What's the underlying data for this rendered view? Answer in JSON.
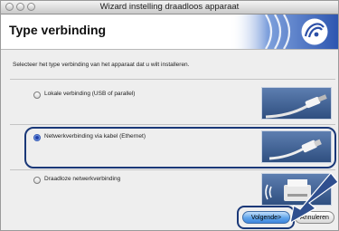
{
  "window": {
    "title": "Wizard instelling draadloos apparaat"
  },
  "header": {
    "title": "Type verbinding",
    "logo_icon": "wireless-signal-icon"
  },
  "instruction": "Selecteer het type verbinding van het apparaat dat u wilt installeren.",
  "options": [
    {
      "label": "Lokale verbinding (USB of parallel)",
      "selected": false,
      "icon": "usb-cable-icon"
    },
    {
      "label": "Netwerkverbinding via kabel (Ethernet)",
      "selected": true,
      "icon": "ethernet-cable-icon"
    },
    {
      "label": "Draadloze netwerkverbinding",
      "selected": false,
      "icon": "wireless-printer-icon"
    }
  ],
  "buttons": {
    "next": "Volgende>",
    "cancel": "Annuleren"
  },
  "colors": {
    "accent": "#1a3878",
    "header_logo": "#3461b8",
    "thumb": "#3f5f95"
  }
}
